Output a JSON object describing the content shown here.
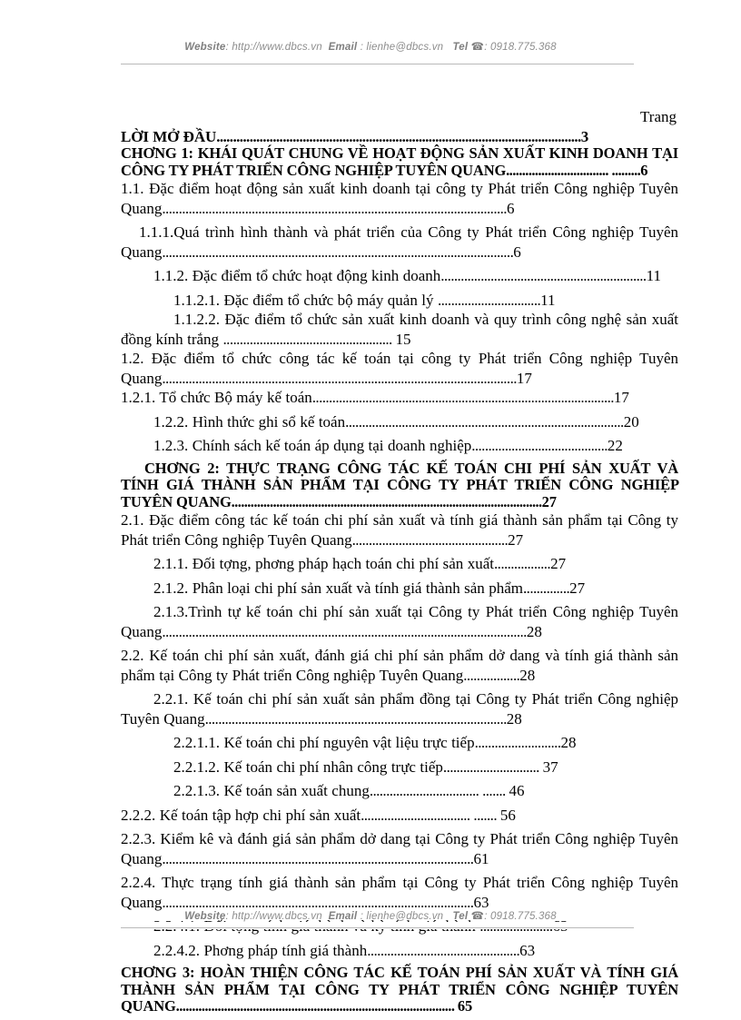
{
  "header": {
    "website_label": "Website",
    "website_value": ": http://www.dbcs.vn",
    "email_label": "Email",
    "email_value": ": lienhe@dbcs.vn",
    "tel_label": "Tel",
    "tel_icon": "telephone-icon",
    "tel_value": ": 0918.775.368",
    "full_line": "Website : http://www.dbcs.vn  Email  : lienhe@dbcs.vn   Tel ☎: 0918.775.368"
  },
  "footer": {
    "website_label": "Website",
    "website_value": ": http://www.dbcs.vn",
    "email_label": "Email",
    "email_value": ": lienhe@dbcs.vn",
    "tel_label": "Tel",
    "tel_icon": "telephone-icon",
    "tel_value": ": 0918.775.368",
    "full_line": "Website : http://www.dbcs.vn  Email  : lienhe@dbcs.vn   Tel ☎: 0918.775.368"
  },
  "toc": {
    "page_column_header": "Trang",
    "entries": [
      {
        "id": "loi-mo-dau",
        "text": "LỜI  MỞ ĐẦU",
        "leader": "..............................................................................................................",
        "page": "3",
        "style": "bold",
        "level": 0
      },
      {
        "id": "chuong-1",
        "line1": "CHƠNG    1: KHÁI QUÁT CHUNG VỀ HOẠT ĐỘNG SẢN XUẤT KINH DOANH TẠI",
        "line2": "CÔNG TY PHÁT TRIỂN CÔNG NGHIỆP TUYÊN QUANG",
        "leader": "................................ .........",
        "page": "6",
        "style": "chapter",
        "level": 0
      },
      {
        "id": "1-1",
        "text": "1.1. Đặc điểm hoạt động sản xuất kinh doanh tại công ty Phát triển Công nghiệp Tuyên Quang",
        "leader": "........................................................................................................",
        "page": "6",
        "style": "normal",
        "level": 0
      },
      {
        "id": "1-1-1",
        "text": "1.1.1.Quá trình hình thành và phát triển của Công ty Phát triển Công nghiệp Tuyên Quang",
        "leader": "..........................................................................................................",
        "page": "6",
        "style": "normal",
        "level": 1
      },
      {
        "id": "1-1-2",
        "text": "1.1.2. Đặc điểm tổ chức hoạt động kinh doanh",
        "leader": "..............................................................",
        "page": "11",
        "style": "normal",
        "level": 2
      },
      {
        "id": "1-1-2-1",
        "text": "1.1.2.1. Đặc điểm tổ chức bộ máy quản lý ",
        "leader": "...............................",
        "page": "11",
        "style": "normal",
        "level": 3
      },
      {
        "id": "1-1-2-2",
        "text": "1.1.2.2.  Đặc điểm tổ chức sản xuất kinh doanh và quy trình công nghệ sản xuất đồng   kính trắng ",
        "leader": "................................................... ",
        "page": "15",
        "style": "normal",
        "level": 3
      },
      {
        "id": "1-2",
        "text": "1.2. Đặc điểm tổ chức công tác kế toán tại công ty Phát triển Công nghiệp Tuyên Quang",
        "leader": "...........................................................................................................",
        "page": "17",
        "style": "normal",
        "level": 0
      },
      {
        "id": "1-2-1",
        "text": "1.2.1. Tổ chức Bộ máy kế toán",
        "leader": "...........................................................................................",
        "page": "17",
        "style": "normal",
        "level": 0
      },
      {
        "id": "1-2-2",
        "text": "1.2.2. Hình thức ghi sổ kế toán",
        "leader": "....................................................................................",
        "page": "20",
        "style": "normal",
        "level": 2
      },
      {
        "id": "1-2-3",
        "text": "1.2.3. Chính sách kế toán áp dụng tại doanh nghiệp",
        "leader": ".........................................",
        "page": "22",
        "style": "normal",
        "level": 2
      },
      {
        "id": "chuong-2",
        "line1": "CHƠNG   2: THỰC TRẠNG CÔNG TÁC KẾ TOÁN CHI PHÍ SẢN XUẤT VÀ",
        "line2": "TÍNH GIÁ THÀNH SẢN PHẨM TẠI CÔNG TY PHÁT TRIỂN CÔNG NGHIỆP",
        "line3": "TUYÊN QUANG",
        "leader": ".................................................................................................",
        "page": "27",
        "style": "chapter",
        "level": 1
      },
      {
        "id": "2-1",
        "text": "2.1. Đặc điểm công tác kế toán chi phí sản xuất và tính giá thành sản phẩm tại Công ty Phát triển Công nghiệp Tuyên Quang",
        "leader": "...............................................",
        "page": "27",
        "style": "normal",
        "level": 0
      },
      {
        "id": "2-1-1",
        "text": "2.1.1. Đối tợng,   phơng   pháp hạch toán chi phí sản xuất",
        "leader": ".................",
        "page": "27",
        "style": "normal",
        "level": 2
      },
      {
        "id": "2-1-2",
        "text": "2.1.2. Phân loại chi phí sản xuất và tính giá thành sản phẩm",
        "leader": "..............",
        "page": "27",
        "style": "normal",
        "level": 2
      },
      {
        "id": "2-1-3",
        "text": "2.1.3.Trình tự kế toán chi phí sản xuất tại Công ty Phát triển Công nghiệp Tuyên Quang",
        "leader": "..............................................................................................................",
        "page": "28",
        "style": "normal",
        "level": 2
      },
      {
        "id": "2-2",
        "text": "2.2. Kế toán chi phí sản xuất, đánh giá chi phí sản phẩm dở dang và tính giá thành sản phẩm tại Công ty Phát triển Công nghiệp Tuyên Quang",
        "leader": ".................",
        "page": "28",
        "style": "normal",
        "level": 0
      },
      {
        "id": "2-2-1",
        "text": "2.2.1. Kế toán chi phí sản xuất sản phẩm đồng  tại Công ty Phát triển Công nghiệp Tuyên Quang",
        "leader": "...........................................................................................",
        "page": "28",
        "style": "normal",
        "level": 2
      },
      {
        "id": "2-2-1-1",
        "text": "2.2.1.1. Kế toán chi phí nguyên vật liệu trực tiếp",
        "leader": "..........................",
        "page": "28",
        "style": "normal",
        "level": 3
      },
      {
        "id": "2-2-1-2",
        "text": "2.2.1.2. Kế toán chi phí nhân công trực tiếp",
        "leader": "............................. ",
        "page": "37",
        "style": "normal",
        "level": 3
      },
      {
        "id": "2-2-1-3",
        "text": "2.2.1.3. Kế toán sản xuất chung",
        "leader": "................................. ....... ",
        "page": "46",
        "style": "normal",
        "level": 3
      },
      {
        "id": "2-2-2",
        "text": "2.2.2. Kế toán tập hợp chi phí sản xuất",
        "leader": "................................. ....... ",
        "page": "56",
        "style": "normal",
        "level": 0
      },
      {
        "id": "2-2-3",
        "text": "2.2.3. Kiểm kê và đánh giá sản phẩm dở dang tại Công ty Phát triển Công nghiệp Tuyên Quang",
        "leader": "..............................................................................................",
        "page": "61",
        "style": "normal",
        "level": 0
      },
      {
        "id": "2-2-4",
        "text": "2.2.4. Thực trạng tính giá thành sản phẩm tại Công ty Phát triển Công nghiệp Tuyên Quang",
        "leader": "..............................................................................................",
        "page": "63",
        "style": "normal",
        "level": 0
      },
      {
        "id": "2-2-4-1",
        "text": "2.2.4.1. Đối tợng  tính giá thành  và kỳ tính giá thành ",
        "leader": "......................",
        "page": "63",
        "style": "normal",
        "level": 2
      },
      {
        "id": "2-2-4-2",
        "text": "2.2.4.2. Phơng   pháp tính giá thành",
        "leader": "..............................................",
        "page": "63",
        "style": "normal",
        "level": 2
      },
      {
        "id": "chuong-3",
        "line1": "CHƠNG   3: HOÀN THIỆN CÔNG TÁC KẾ TOÁN PHÍ SẢN XUẤT VÀ TÍNH GIÁ",
        "line2": "THÀNH SẢN PHẨM TẠI CÔNG TY PHÁT TRIỂN CÔNG NGHIỆP TUYÊN",
        "line3": "QUANG",
        "leader": "....................................................................................... ",
        "page": "65",
        "style": "chapter",
        "level": 0
      }
    ]
  }
}
